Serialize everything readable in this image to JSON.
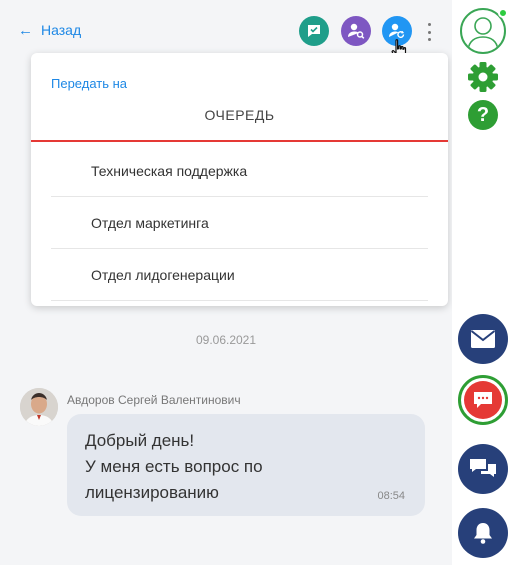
{
  "header": {
    "back_label": "Назад",
    "icons": [
      "message-check-icon",
      "user-search-icon",
      "user-transfer-icon",
      "more-vertical-icon"
    ]
  },
  "dropdown": {
    "title": "Передать на",
    "tab": "ОЧЕРЕДЬ",
    "items": [
      {
        "label": "Техническая поддержка"
      },
      {
        "label": "Отдел маркетинга"
      },
      {
        "label": "Отдел лидогенерации"
      }
    ]
  },
  "chat": {
    "date": "09.06.2021",
    "message": {
      "sender": "Авдоров Сергей Валентинович",
      "lines": [
        "Добрый день!",
        "У меня есть вопрос по",
        "лицензированию"
      ],
      "time": "08:54"
    }
  },
  "rail": {
    "icons": [
      "user-profile-icon",
      "gear-icon",
      "help-icon",
      "mail-icon",
      "chat-icon",
      "messages-icon",
      "bell-icon"
    ]
  },
  "colors": {
    "accent_blue": "#1e88e5",
    "tab_underline": "#e53935",
    "rail_navy": "#27407a",
    "rail_green": "#2e9e34"
  }
}
